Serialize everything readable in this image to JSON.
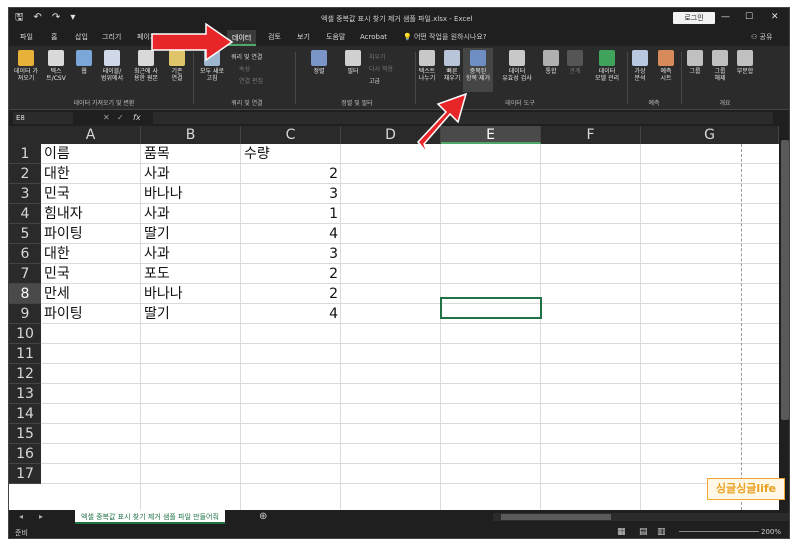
{
  "window": {
    "title": "엑셀 중복값 표시 찾기 제거 샘플 파일.xlsx  -  Excel",
    "login_label": "로그인",
    "quick_access": [
      "🖫",
      "↶",
      "↷",
      "▾"
    ],
    "controls": [
      "⊡",
      "—",
      "☐",
      "✕"
    ]
  },
  "tabs": [
    "파일",
    "홈",
    "삽입",
    "그리기",
    "페이지",
    "수식",
    "데이터",
    "검토",
    "보기",
    "도움말",
    "Acrobat"
  ],
  "active_tab": "데이터",
  "tell_me": "어떤 작업을 원하시나요?",
  "share_label": "공유",
  "ribbon": {
    "groups": [
      {
        "label": "데이터 가져오기 및 변환",
        "buttons": [
          "데이터 가\n져오기",
          "텍스\n트/CSV",
          "웹",
          "테이블/\n범위에서",
          "최근에 사\n용한 원본",
          "기존\n연결"
        ]
      },
      {
        "label": "쿼리 및 연결",
        "buttons": [
          "모두 새로\n고침"
        ],
        "small": [
          "쿼리 및 연결",
          "속성",
          "연결 편집"
        ]
      },
      {
        "label": "정렬 및 필터",
        "buttons": [
          "정렬",
          "필터"
        ],
        "small": [
          "지우기",
          "다시 적용",
          "고급"
        ]
      },
      {
        "label": "데이터 도구",
        "buttons": [
          "텍스트\n나누기",
          "빠른\n채우기",
          "중복된\n항목 제거",
          "데이터\n유효성 검사",
          "통합",
          "관계",
          "데이터\n모델 관리"
        ]
      },
      {
        "label": "예측",
        "buttons": [
          "가상\n분석",
          "예측\n시트"
        ]
      },
      {
        "label": "개요",
        "buttons": [
          "그룹",
          "그룹\n해제",
          "부분합"
        ]
      }
    ]
  },
  "formula_bar": {
    "name_box": "E8",
    "fx": "fx",
    "value": ""
  },
  "sheet": {
    "columns": [
      "A",
      "B",
      "C",
      "D",
      "E",
      "F",
      "G"
    ],
    "row_numbers": [
      "1",
      "2",
      "3",
      "4",
      "5",
      "6",
      "7",
      "8",
      "9",
      "10",
      "11",
      "12",
      "13",
      "14",
      "15",
      "16",
      "17"
    ],
    "selected_cell": "E8",
    "rows": [
      {
        "a": "이름",
        "b": "품목",
        "c": "수량"
      },
      {
        "a": "대한",
        "b": "사과",
        "c": "2"
      },
      {
        "a": "민국",
        "b": "바나나",
        "c": "3"
      },
      {
        "a": "힘내자",
        "b": "사과",
        "c": "1"
      },
      {
        "a": "파이팅",
        "b": "딸기",
        "c": "4"
      },
      {
        "a": "대한",
        "b": "사과",
        "c": "3"
      },
      {
        "a": "민국",
        "b": "포도",
        "c": "2"
      },
      {
        "a": "만세",
        "b": "바나나",
        "c": "2"
      },
      {
        "a": "파이팅",
        "b": "딸기",
        "c": "4"
      }
    ]
  },
  "sheet_tab": "엑셀 중복값 표시 찾기 제거 샘플 파일 만들어줘",
  "status": {
    "left": "준비",
    "zoom": "200%"
  },
  "watermark": "싱글싱글life",
  "colors": {
    "accent": "#217346",
    "arrow": "#e8262a",
    "dark_bg": "#1f1f1f",
    "ribbon_bg": "#2b2b2b"
  }
}
